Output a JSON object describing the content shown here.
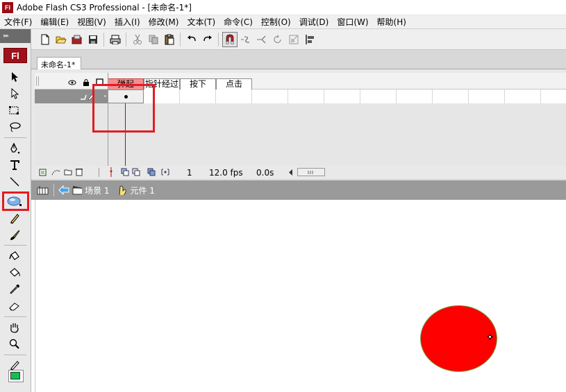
{
  "window": {
    "icon_label": "Fl",
    "title": "Adobe Flash CS3 Professional - [未命名-1*]"
  },
  "menu": [
    "文件(F)",
    "编辑(E)",
    "视图(V)",
    "插入(I)",
    "修改(M)",
    "文本(T)",
    "命令(C)",
    "控制(O)",
    "调试(D)",
    "窗口(W)",
    "帮助(H)"
  ],
  "tools": {
    "logo": "Fl",
    "items": [
      "selection-tool",
      "subselection-tool",
      "free-transform-tool",
      "lasso-tool",
      "pen-tool",
      "text-tool",
      "line-tool",
      "oval-tool",
      "pencil-tool",
      "brush-tool",
      "ink-bottle-tool",
      "paint-bucket-tool",
      "eyedropper-tool",
      "eraser-tool",
      "hand-tool",
      "zoom-tool",
      "stroke-color",
      "fill-color"
    ],
    "fill_color": "#11c050",
    "highlight_color": "#e21b23"
  },
  "toolbar": [
    "new-icon",
    "open-icon",
    "bridge-icon",
    "save-icon",
    "print-icon",
    "cut-icon",
    "copy-icon",
    "paste-icon",
    "undo-icon",
    "redo-icon",
    "snap-magnet-icon",
    "smooth-icon",
    "straighten-icon",
    "rotate-icon",
    "scale-icon",
    "align-icon"
  ],
  "document": {
    "tab": "未命名-1*"
  },
  "timeline": {
    "frames": [
      "弹起",
      "指针经过",
      "按下",
      "点击"
    ],
    "active_frame": "弹起",
    "current_frame": "1",
    "fps": "12.0 fps",
    "time": "0.0s",
    "layer_color": "#5ef04a"
  },
  "editbar": {
    "scene": "场景 1",
    "symbol": "元件 1"
  },
  "stage": {
    "shape_fill": "#fe0000",
    "shape_stroke": "#6fa64a"
  }
}
